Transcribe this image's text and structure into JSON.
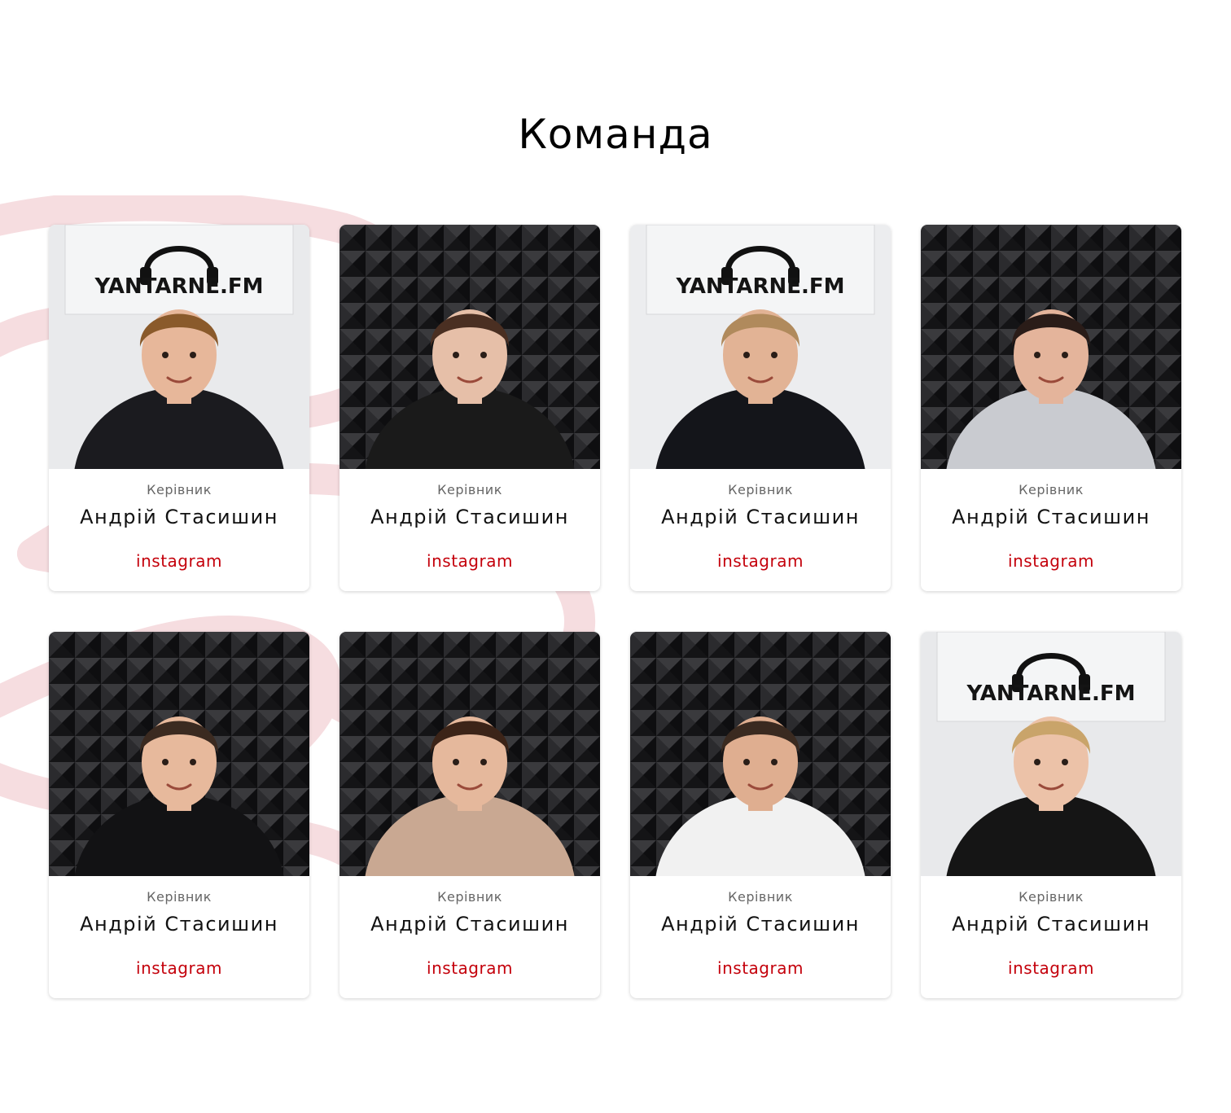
{
  "section": {
    "title": "Команда"
  },
  "team": [
    {
      "role": "Керівник",
      "name": "Андрій Стасишин",
      "link_label": "instagram",
      "photo_desc": "photo-man-thumbs-up",
      "logo_text": "YANTARNE.FM",
      "bg": "#e9eaec",
      "shirt": "#1b1b1f",
      "hair": "#8a5a2b",
      "skin": "#e7b79a",
      "variant": "logo"
    },
    {
      "role": "Керівник",
      "name": "Андрій Стасишин",
      "link_label": "instagram",
      "photo_desc": "photo-woman-studio",
      "logo_text": "",
      "bg": "#2a2a2c",
      "shirt": "#1a1a1a",
      "hair": "#4a2f22",
      "skin": "#e6bfa8",
      "variant": "foam"
    },
    {
      "role": "Керівник",
      "name": "Андрій Стасишин",
      "link_label": "instagram",
      "photo_desc": "photo-man-phone",
      "logo_text": "YANTARNE.FM",
      "bg": "#ecedef",
      "shirt": "#14151a",
      "hair": "#b08a5c",
      "skin": "#e2b395",
      "variant": "logo"
    },
    {
      "role": "Керівник",
      "name": "Андрій Стасишин",
      "link_label": "instagram",
      "photo_desc": "photo-woman-headphones",
      "logo_text": "",
      "bg": "#2b2b2d",
      "shirt": "#c9cbd0",
      "hair": "#2a1c18",
      "skin": "#e4b49b",
      "variant": "foam"
    },
    {
      "role": "Керівник",
      "name": "Андрій Стасишин",
      "link_label": "instagram",
      "photo_desc": "photo-man-microphone",
      "logo_text": "",
      "bg": "#2c2c2e",
      "shirt": "#121214",
      "hair": "#3b2a20",
      "skin": "#e7b99c",
      "variant": "foam"
    },
    {
      "role": "Керівник",
      "name": "Андрій Стасишин",
      "link_label": "instagram",
      "photo_desc": "photo-woman-sweater",
      "logo_text": "",
      "bg": "#2a2a2c",
      "shirt": "#c9a892",
      "hair": "#3c2418",
      "skin": "#e5b89c",
      "variant": "foam"
    },
    {
      "role": "Керівник",
      "name": "Андрій Стасишин",
      "link_label": "instagram",
      "photo_desc": "photo-man-beard",
      "logo_text": "",
      "bg": "#2b2b2d",
      "shirt": "#f1f1f1",
      "hair": "#3a2a20",
      "skin": "#dfae90",
      "variant": "foam"
    },
    {
      "role": "Керівник",
      "name": "Андрій Стасишин",
      "link_label": "instagram",
      "photo_desc": "photo-woman-logo-wall",
      "logo_text": "YANTARNE.FM",
      "bg": "#e8e9eb",
      "shirt": "#151515",
      "hair": "#c9a46a",
      "skin": "#ecc2a8",
      "variant": "logo"
    }
  ]
}
